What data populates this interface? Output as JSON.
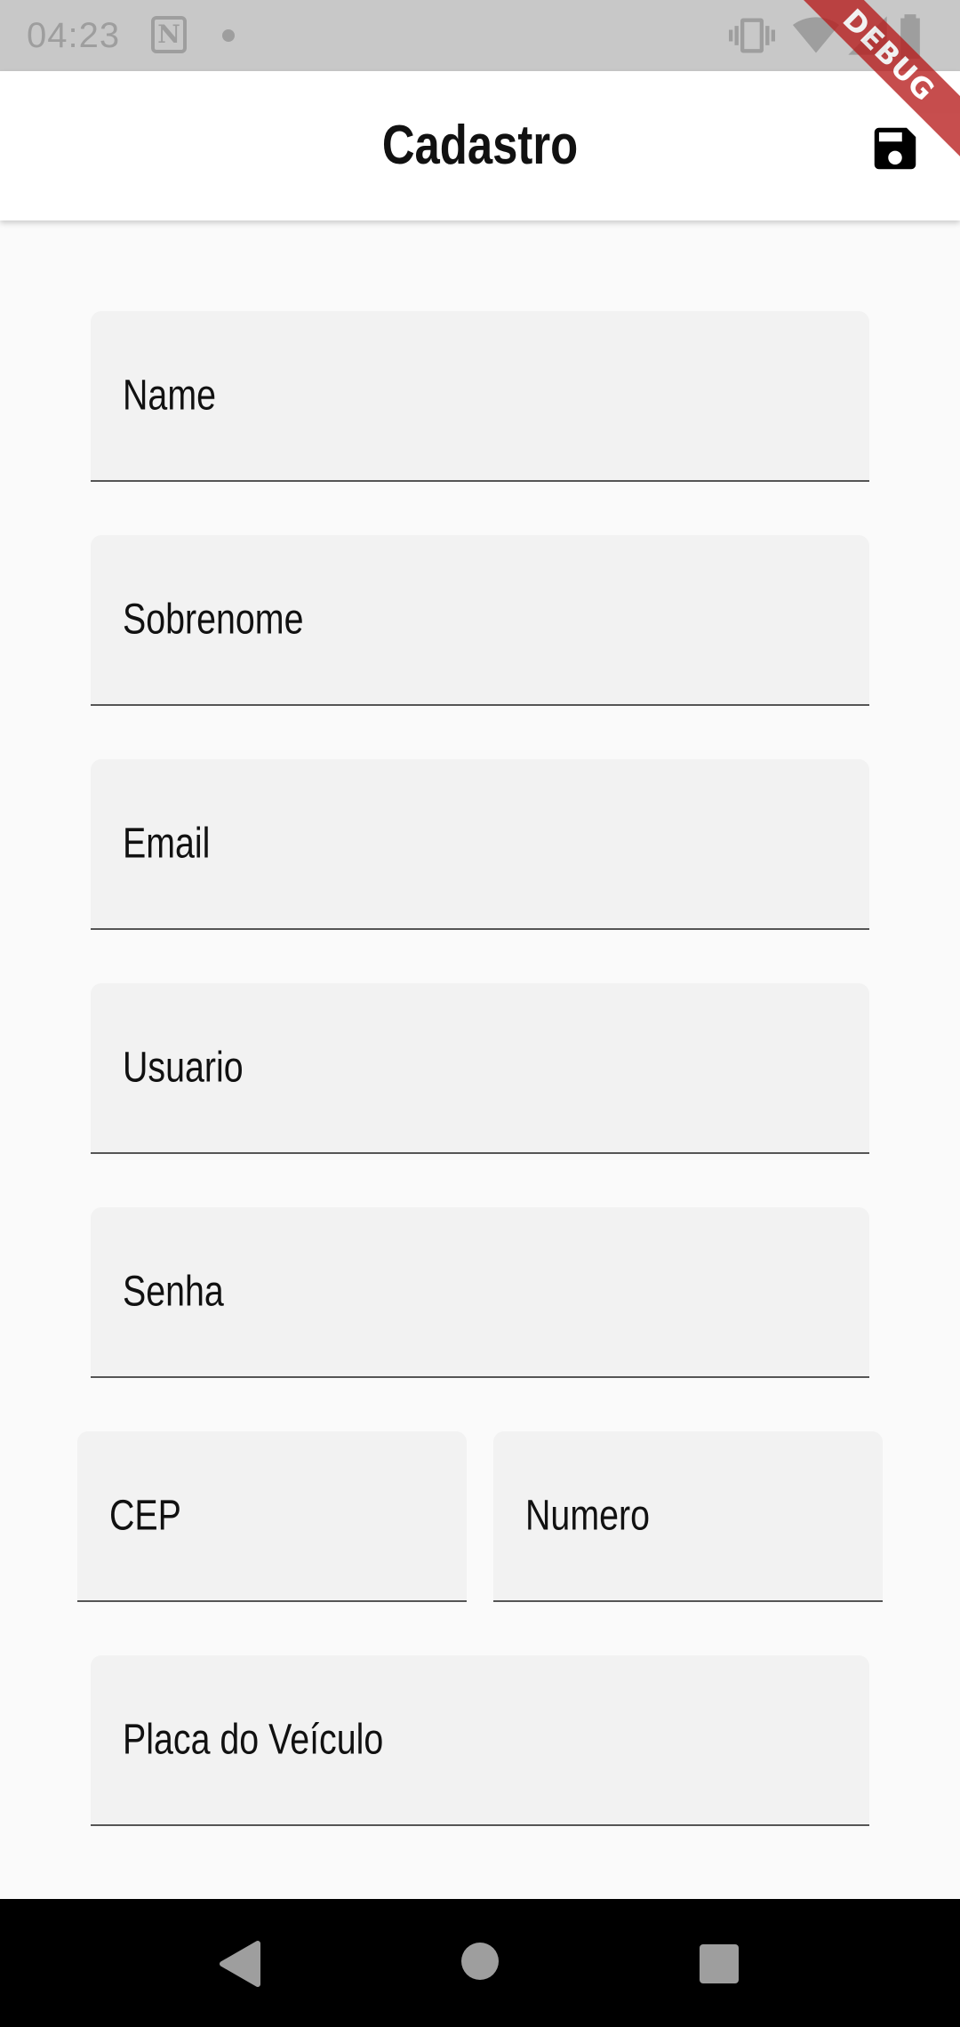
{
  "status_bar": {
    "time": "04:23",
    "app_icon": "N",
    "icons": [
      "vibrate-icon",
      "wifi-icon",
      "signal-icon",
      "battery-icon"
    ]
  },
  "debug_banner": "DEBUG",
  "app_bar": {
    "title": "Cadastro",
    "save_icon": "save-icon"
  },
  "form": {
    "name_label": "Name",
    "surname_label": "Sobrenome",
    "email_label": "Email",
    "user_label": "Usuario",
    "password_label": "Senha",
    "cep_label": "CEP",
    "number_label": "Numero",
    "plate_label": "Placa do Veículo"
  },
  "nav_bar": {
    "buttons": [
      "back-icon",
      "home-icon",
      "recents-icon"
    ]
  }
}
